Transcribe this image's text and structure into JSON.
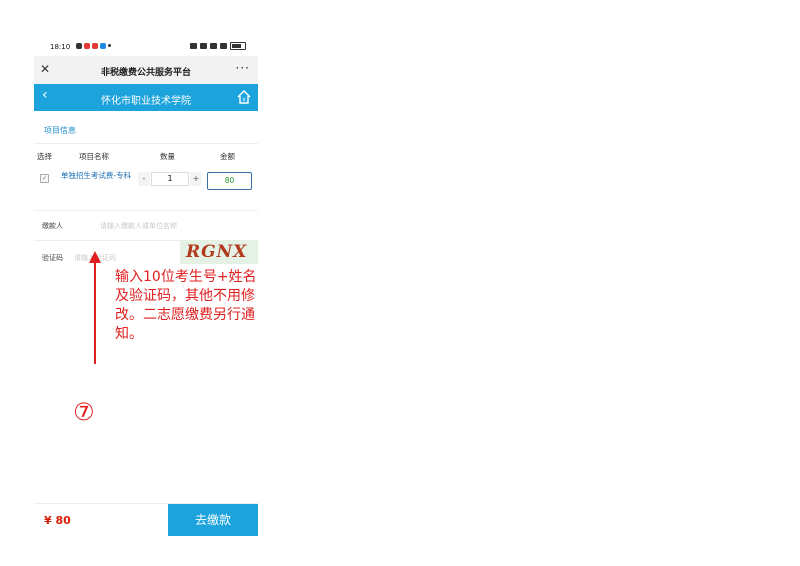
{
  "status_bar": {
    "time": "18:10"
  },
  "title_bar": {
    "close_glyph": "✕",
    "title": "非税缴费公共服务平台",
    "more_glyph": "···"
  },
  "nav_bar": {
    "back_glyph": "‹",
    "title": "怀化市职业技术学院",
    "home_icon": "home-icon"
  },
  "section": {
    "title": "项目信息"
  },
  "table": {
    "headers": [
      "选择",
      "项目名称",
      "数量",
      "金额"
    ],
    "row": {
      "name": "单独招生考试费-专科",
      "minus": "-",
      "qty": "1",
      "plus": "+",
      "amount": "80"
    }
  },
  "payer": {
    "label": "缴款人",
    "placeholder": "请输入缴款人或单位名称"
  },
  "captcha": {
    "label": "验证码",
    "placeholder": "请输入验证码",
    "image_text": "RGNX"
  },
  "footer": {
    "total": "¥ 80",
    "pay_label": "去缴款"
  },
  "annotation": {
    "text": "输入10位考生号+姓名及验证码，其他不用修改。二志愿缴费另行通知。",
    "number": "⑦",
    "color": "#e02020"
  },
  "colors": {
    "accent": "#1ca3dc",
    "link": "#1b8fc7",
    "price": "#d81e06"
  }
}
